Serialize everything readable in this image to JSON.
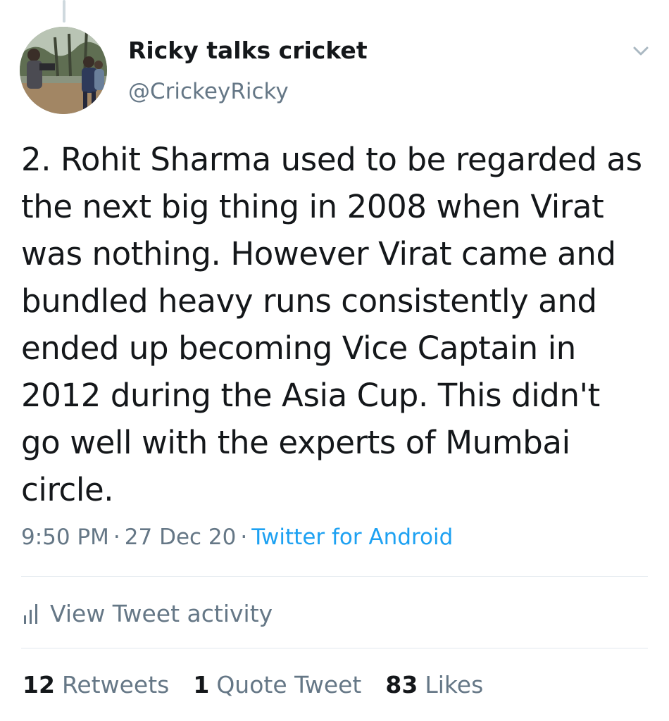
{
  "tweet": {
    "author": {
      "display_name": "Ricky talks cricket",
      "handle": "@CrickeyRicky",
      "avatar_icon": "profile-photo"
    },
    "menu_icon": "chevron-down-icon",
    "text": "2. Rohit Sharma used to be regarded as the next big thing in 2008 when Virat was nothing. However Virat came and bundled heavy runs consistently and ended up becoming Vice Captain in 2012 during the Asia Cup. This didn't go well with the experts of Mumbai circle.",
    "meta": {
      "time": "9:50 PM",
      "date": "27 Dec 20",
      "separator": "·",
      "source": "Twitter for Android"
    },
    "activity": {
      "icon": "bar-chart-icon",
      "label": "View Tweet activity"
    },
    "stats": {
      "retweets": {
        "count": "12",
        "label": "Retweets"
      },
      "quote_tweets": {
        "count": "1",
        "label": "Quote Tweet"
      },
      "likes": {
        "count": "83",
        "label": "Likes"
      }
    }
  },
  "colors": {
    "text_primary": "#14171a",
    "text_secondary": "#657786",
    "link": "#1da1f2",
    "divider": "#e1e8ed"
  }
}
